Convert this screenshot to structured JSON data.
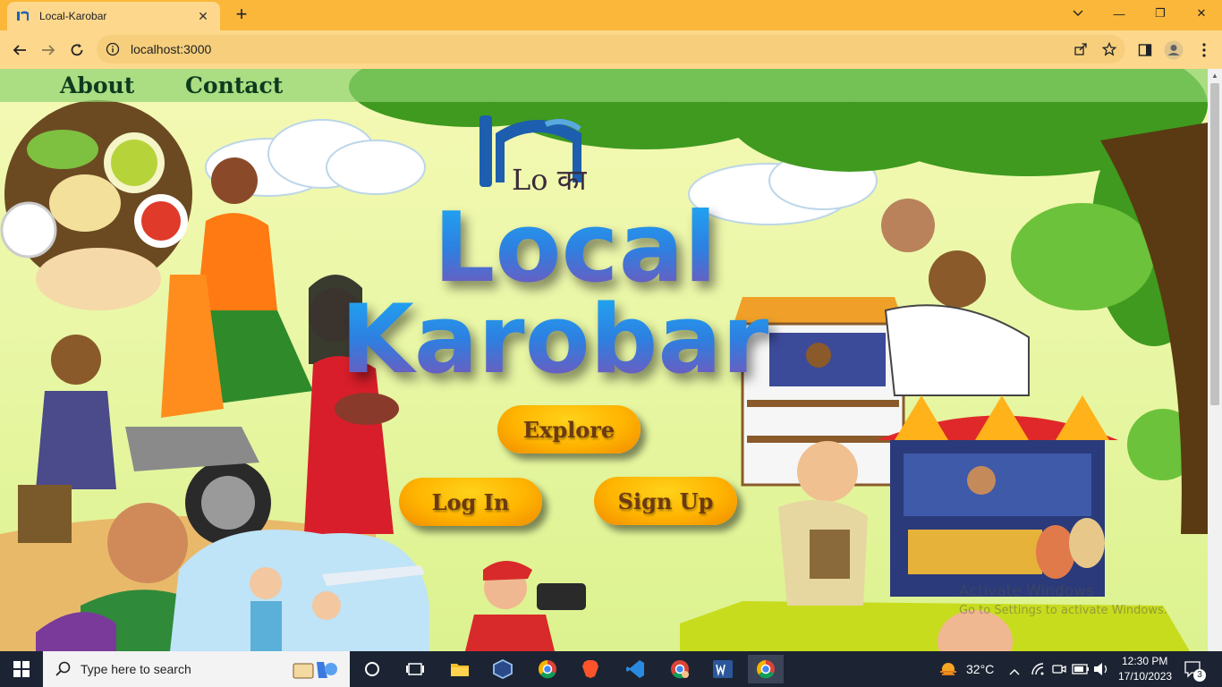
{
  "browser": {
    "tab_title": "Local-Karobar",
    "tab_close": "✕",
    "new_tab": "+",
    "url": "localhost:3000",
    "window_controls": {
      "minimize": "—",
      "restore": "❐",
      "close": "✕"
    }
  },
  "nav": {
    "about": "About",
    "contact": "Contact"
  },
  "logo": {
    "text": "Lo का"
  },
  "hero": {
    "line1": "Local",
    "line2": "Karobar"
  },
  "buttons": {
    "explore": "Explore",
    "login": "Log In",
    "signup": "Sign Up"
  },
  "watermark": {
    "line1": "Activate Windows",
    "line2": "Go to Settings to activate Windows."
  },
  "taskbar": {
    "search_placeholder": "Type here to search",
    "temperature": "32°C",
    "time": "12:30 PM",
    "date": "17/10/2023",
    "notification_count": "3"
  },
  "colors": {
    "tab_strip": "#fbb73a",
    "toolbar": "#fdd88c",
    "nav_text": "#0d3b1e",
    "button": "#ffb400",
    "hero_top": "#1fa5f2",
    "hero_bottom": "#7a55b8"
  }
}
